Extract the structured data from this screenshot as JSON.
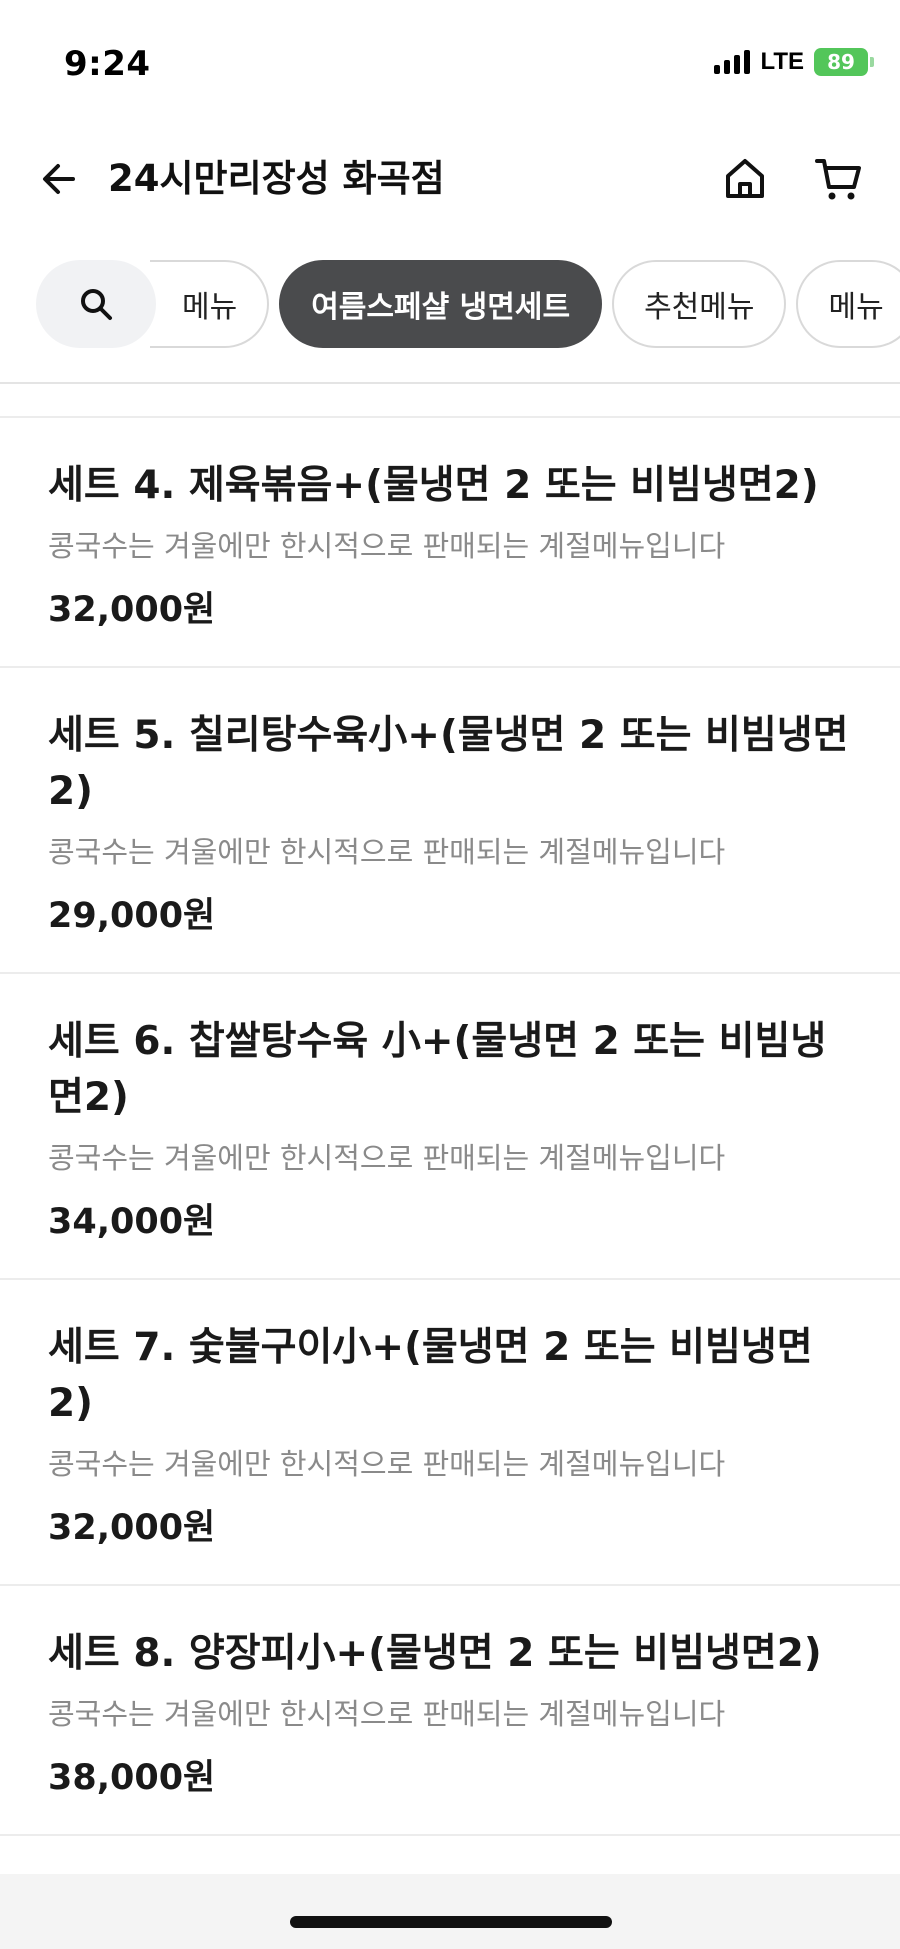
{
  "status": {
    "time": "9:24",
    "network": "LTE",
    "battery": "89"
  },
  "header": {
    "title": "24시만리장성 화곡점",
    "back_icon": "arrow-left-icon",
    "home_icon": "home-icon",
    "cart_icon": "cart-icon"
  },
  "categories": {
    "search_icon": "search-icon",
    "items": [
      {
        "label": "메뉴",
        "active": false
      },
      {
        "label": "여름스페샬 냉면세트",
        "active": true
      },
      {
        "label": "추천메뉴",
        "active": false
      },
      {
        "label": "메뉴",
        "active": false
      }
    ]
  },
  "menu": {
    "items": [
      {
        "name": "세트 4. 제육볶음+(물냉면 2 또는 비빔냉면2)",
        "desc": "콩국수는 겨울에만 한시적으로 판매되는 계절메뉴입니다",
        "price": "32,000원"
      },
      {
        "name": "세트 5. 칠리탕수육小+(물냉면 2 또는 비빔냉면2)",
        "desc": "콩국수는 겨울에만 한시적으로 판매되는 계절메뉴입니다",
        "price": "29,000원"
      },
      {
        "name": "세트 6. 찹쌀탕수육 小+(물냉면 2 또는 비빔냉면2)",
        "desc": "콩국수는 겨울에만 한시적으로 판매되는 계절메뉴입니다",
        "price": "34,000원"
      },
      {
        "name": "세트 7. 숯불구이小+(물냉면 2 또는 비빔냉면2)",
        "desc": "콩국수는 겨울에만 한시적으로 판매되는 계절메뉴입니다",
        "price": "32,000원"
      },
      {
        "name": "세트 8. 양장피小+(물냉면 2 또는 비빔냉면2)",
        "desc": "콩국수는 겨울에만 한시적으로 판매되는 계절메뉴입니다",
        "price": "38,000원"
      }
    ]
  },
  "colors": {
    "active_chip": "#4a4b4d",
    "battery": "#53c65a",
    "desc_text": "#8a8a8a"
  }
}
